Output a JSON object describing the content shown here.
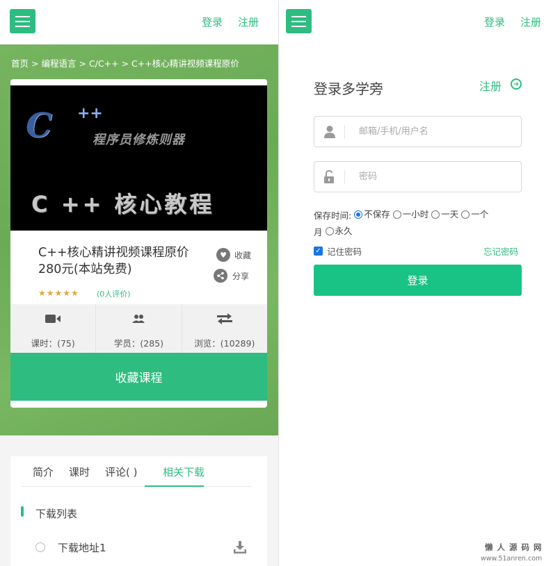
{
  "header": {
    "login_label": "登录",
    "register_label": "注册"
  },
  "breadcrumb": {
    "items": [
      "首页",
      "编程语言",
      "C/C++",
      "C++核心精讲视频课程原价"
    ],
    "separator": ">"
  },
  "course": {
    "cover": {
      "logo_text": "C",
      "logo_plus": "++",
      "subtitle": "程序员修炼则器",
      "title": "C ++ 核心教程"
    },
    "title": "C++核心精讲视频课程原价280元(本站免费)",
    "favorite_label": "收藏",
    "share_label": "分享",
    "rating_stars": "★★★★★",
    "reviews": "(0人评价)",
    "stats": [
      {
        "icon": "video-camera-icon",
        "text": "课时：(75)"
      },
      {
        "icon": "users-icon",
        "text": "学员：(285)"
      },
      {
        "icon": "exchange-arrows-icon",
        "text": "浏览：(10289)"
      }
    ],
    "collect_button": "收藏课程"
  },
  "tabs": {
    "items": [
      "简介",
      "课时",
      "评论( )",
      "相关下载"
    ],
    "active_index": 3
  },
  "downloads": {
    "heading": "下载列表",
    "items": [
      {
        "label": "下载地址1"
      }
    ]
  },
  "login": {
    "title": "登录多学旁",
    "register_link": "注册",
    "username_placeholder": "邮箱/手机/用户名",
    "password_placeholder": "密码",
    "keep_label": "保存时间:",
    "keep_options": [
      "不保存",
      "一小时",
      "一天",
      "一个月",
      "永久"
    ],
    "keep_options_display": [
      "不保存",
      "一小时",
      "一天",
      "一个",
      "月",
      "永久"
    ],
    "keep_selected_index": 0,
    "remember_label": "记住密码",
    "remember_checked": true,
    "forgot_label": "忘记密码",
    "submit_label": "登录"
  },
  "watermark": {
    "line1": "懒人源码网",
    "line2": "www.51anren.com"
  },
  "colors": {
    "accent": "#2ebc80",
    "hero_green": "#70b05a",
    "login_button": "#19c385",
    "radio_blue": "#1a73e8"
  }
}
